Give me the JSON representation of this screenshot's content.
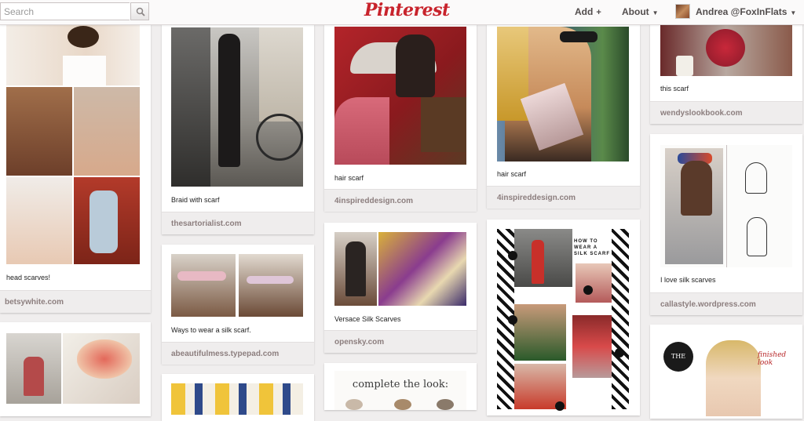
{
  "header": {
    "search_placeholder": "Search",
    "logo": "Pinterest",
    "add_label": "Add",
    "about_label": "About",
    "user_label": "Andrea @FoxInFlats",
    "logo_color": "#c8232c"
  },
  "pins": [
    {
      "caption": "head scarves!",
      "source": "betsywhite.com"
    },
    {
      "caption": "Braid with scarf",
      "source": "thesartorialist.com"
    },
    {
      "caption": "Ways to wear a silk scarf.",
      "source": "abeautifulmess.typepad.com"
    },
    {
      "caption": "hair scarf",
      "source": "4inspireddesign.com"
    },
    {
      "caption": "Versace Silk Scarves",
      "source": "opensky.com"
    },
    {
      "caption": "hair scarf",
      "source": "4inspireddesign.com"
    },
    {
      "caption": "this scarf",
      "source": "wendyslookbook.com"
    },
    {
      "caption": "I love silk scarves",
      "source": "callastyle.wordpress.com"
    }
  ],
  "image_text": {
    "complete_look": "complete the look:",
    "how_to_wear": "HOW TO WEAR A SILK SCARF",
    "the_city": "THE CITY",
    "finished_look": "finished look"
  }
}
